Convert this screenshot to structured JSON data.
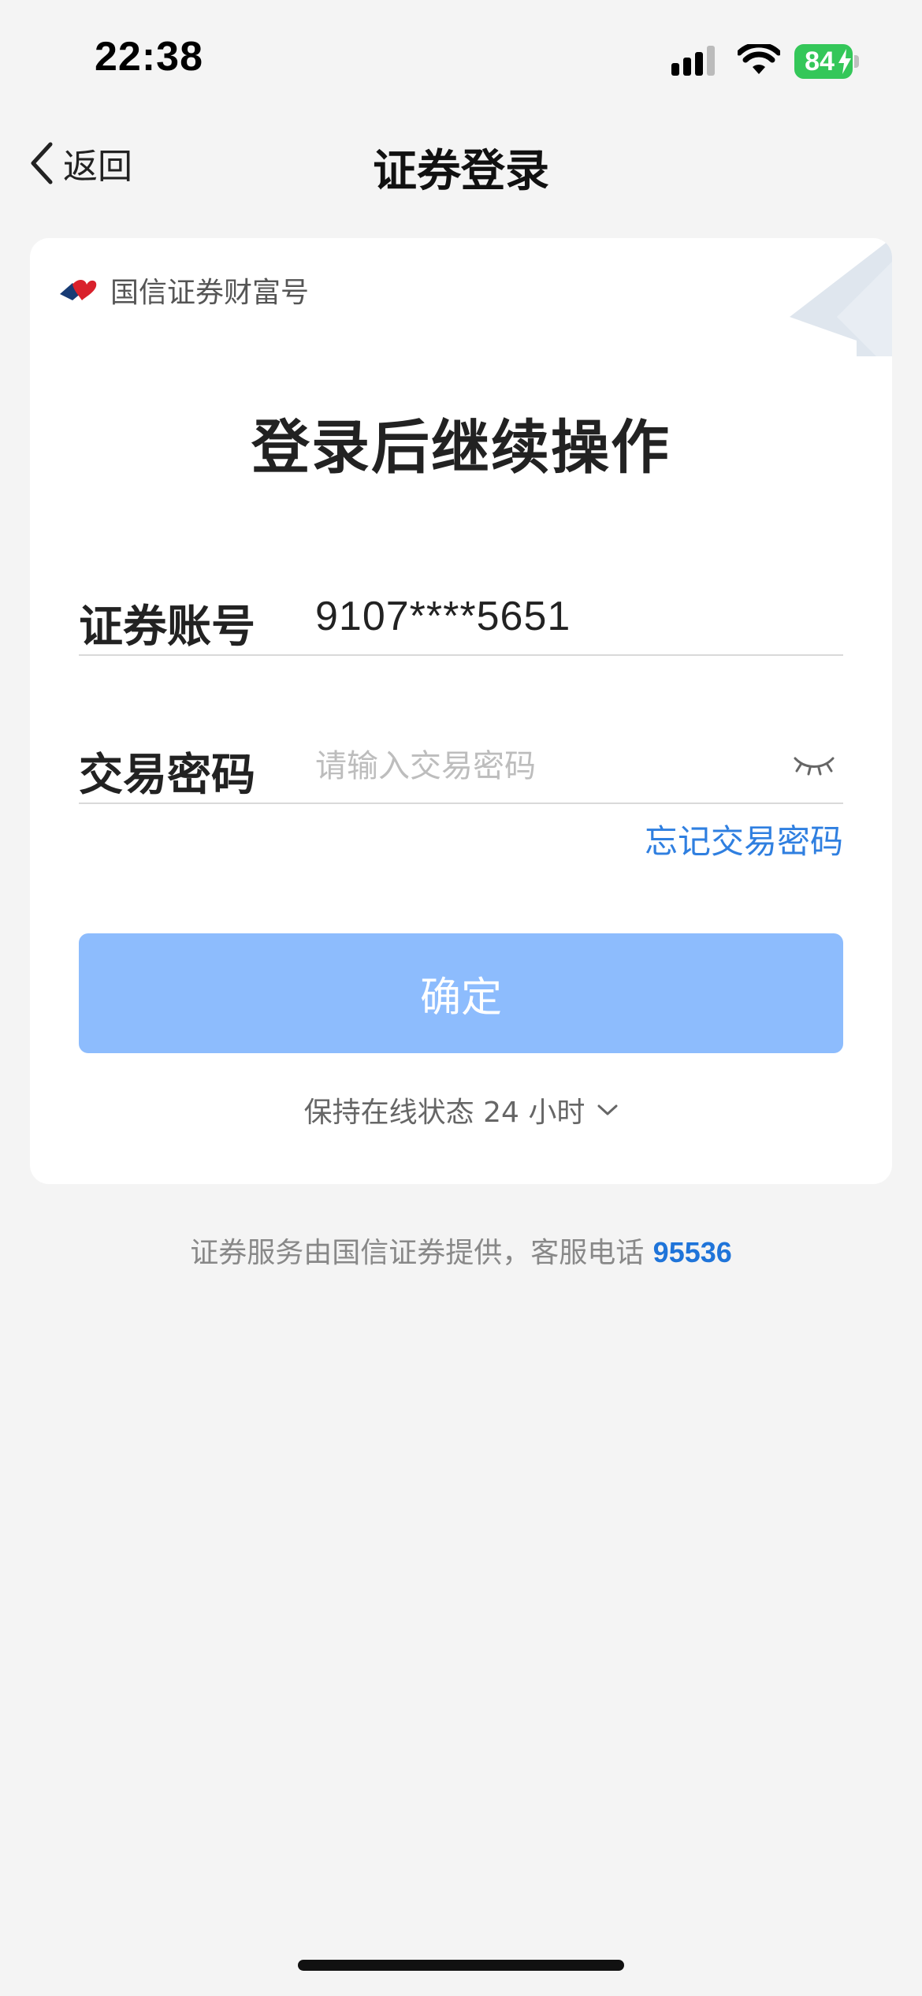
{
  "status_bar": {
    "time": "22:38",
    "battery_level": "84",
    "icons": [
      "signal-icon",
      "wifi-icon",
      "battery-icon",
      "bolt-icon"
    ]
  },
  "nav": {
    "back_label": "返回",
    "title": "证券登录"
  },
  "card": {
    "brand_name": "国信证券财富号",
    "heading": "登录后继续操作",
    "account": {
      "label": "证券账号",
      "value": "9107****5651"
    },
    "password": {
      "label": "交易密码",
      "placeholder": "请输入交易密码"
    },
    "forgot_label": "忘记交易密码",
    "confirm_label": "确定",
    "keep_online_label": "保持在线状态 24 小时"
  },
  "footer": {
    "text": "证券服务由国信证券提供，客服电话 ",
    "phone": "95536"
  },
  "colors": {
    "accent": "#2f7fe0",
    "button_disabled": "#8dbcfd",
    "background": "#f4f4f4",
    "battery": "#34c759"
  }
}
